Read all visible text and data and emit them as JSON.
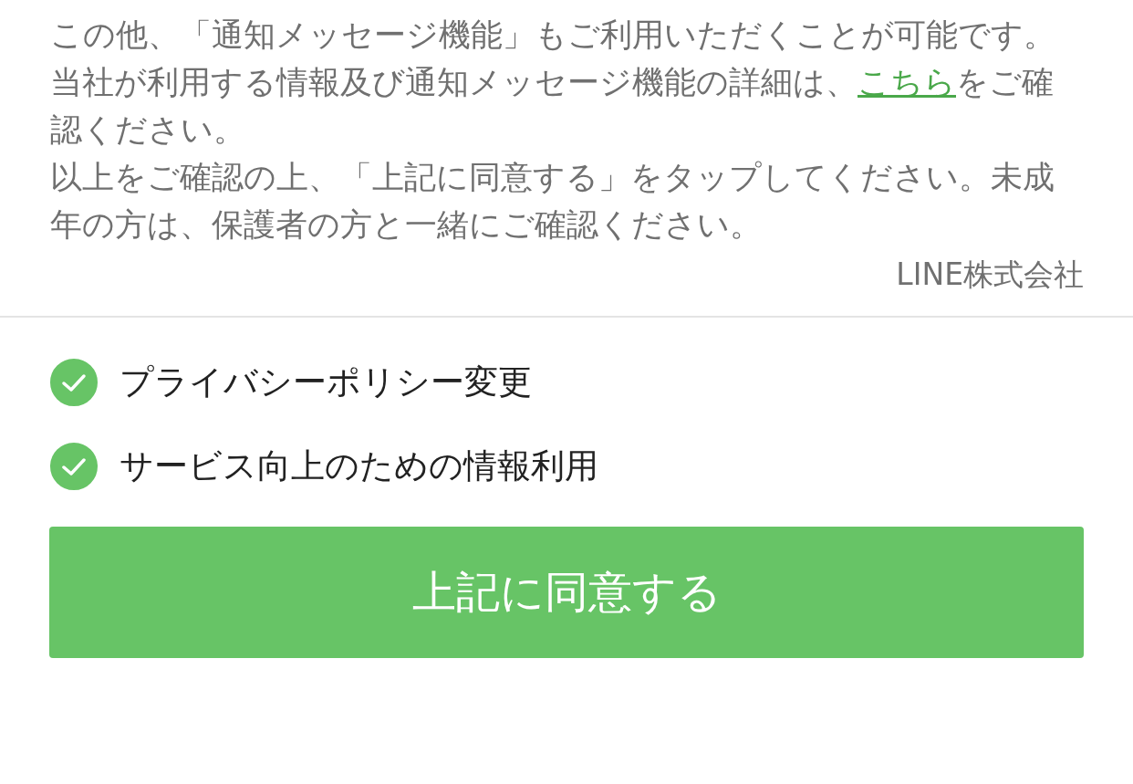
{
  "notice": {
    "paragraphs": [
      {
        "before": "この他、「通知メッセージ機能」もご利用いただくことが可能です。"
      },
      {
        "before": "当社が利用する情報及び通知メッセージ機能の詳細は、",
        "link": "こちら",
        "after": "をご確認ください。"
      },
      {
        "before": "以上をご確認の上、「上記に同意する」をタップしてください。未成年の方は、保護者の方と一緒にご確認ください。"
      }
    ],
    "signature": "LINE株式会社"
  },
  "consents": [
    {
      "label": "プライバシーポリシー変更",
      "checked": true
    },
    {
      "label": "サービス向上のための情報利用",
      "checked": true
    }
  ],
  "agree_button": "上記に同意する"
}
